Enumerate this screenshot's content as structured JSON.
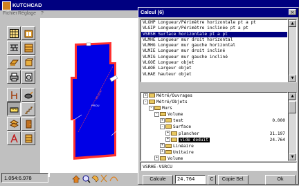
{
  "app": {
    "title": "KUTCHCAD",
    "menu": [
      "Fichier",
      "Réglage",
      "?"
    ],
    "coordinates": "1.054:6.978"
  },
  "canvas": {
    "room_label": "PROU",
    "dimension_label": "40.10 m",
    "colors": {
      "room_fill": "#0000e6",
      "room_border": "#ff3030",
      "background": "#ffffff"
    }
  },
  "dialog": {
    "title": "Calcul (6)",
    "close_label": "×",
    "commands": [
      "VLGHP Longueur/Périmètre horizontale pt a pt",
      "VLGIP Longueur/Périmètre inclinée pt a pt",
      "VSRSH Surface horizontale pt a pt",
      "VLMHE Longueur mur droit horizontal",
      "VLMHG Longueur mur gauche horizontal",
      "VLMIE Longueur mur droit incliné",
      "VLMIG Longueur mur gauche incliné",
      "VLGOE Longueur objet",
      "VLAOE Largeur objet",
      "VLHAE hauteur objet"
    ],
    "selected_command_index": 2,
    "tree": [
      {
        "indent": 0,
        "toggle": "+",
        "label": "Métré/Ouvrages",
        "value": ""
      },
      {
        "indent": 0,
        "toggle": "-",
        "label": "Métré/Objets",
        "value": ""
      },
      {
        "indent": 1,
        "toggle": "-",
        "label": "Murs",
        "value": ""
      },
      {
        "indent": 2,
        "toggle": "-",
        "label": "Volume",
        "value": ""
      },
      {
        "indent": 3,
        "toggle": "+",
        "label": "test",
        "value": "0.000"
      },
      {
        "indent": 3,
        "toggle": "-",
        "label": "Surface",
        "value": ""
      },
      {
        "indent": 4,
        "toggle": "+",
        "label": "plancher",
        "value": "31.197"
      },
      {
        "indent": 4,
        "toggle": "+",
        "label": "vide deduit",
        "value": "24.764",
        "selected": true
      },
      {
        "indent": 3,
        "toggle": "+",
        "label": "Linéaire",
        "value": ""
      },
      {
        "indent": 3,
        "toggle": "+",
        "label": "Unitaire",
        "value": ""
      },
      {
        "indent": 2,
        "toggle": "+",
        "label": "Volume",
        "value": ""
      }
    ],
    "expression": "VSRHE-VSRCU",
    "buttons": {
      "calcule": "Calcule",
      "c": "C",
      "copie_sel": "Copie Sel.",
      "ok": "Ok"
    },
    "result_value": "24.764"
  }
}
